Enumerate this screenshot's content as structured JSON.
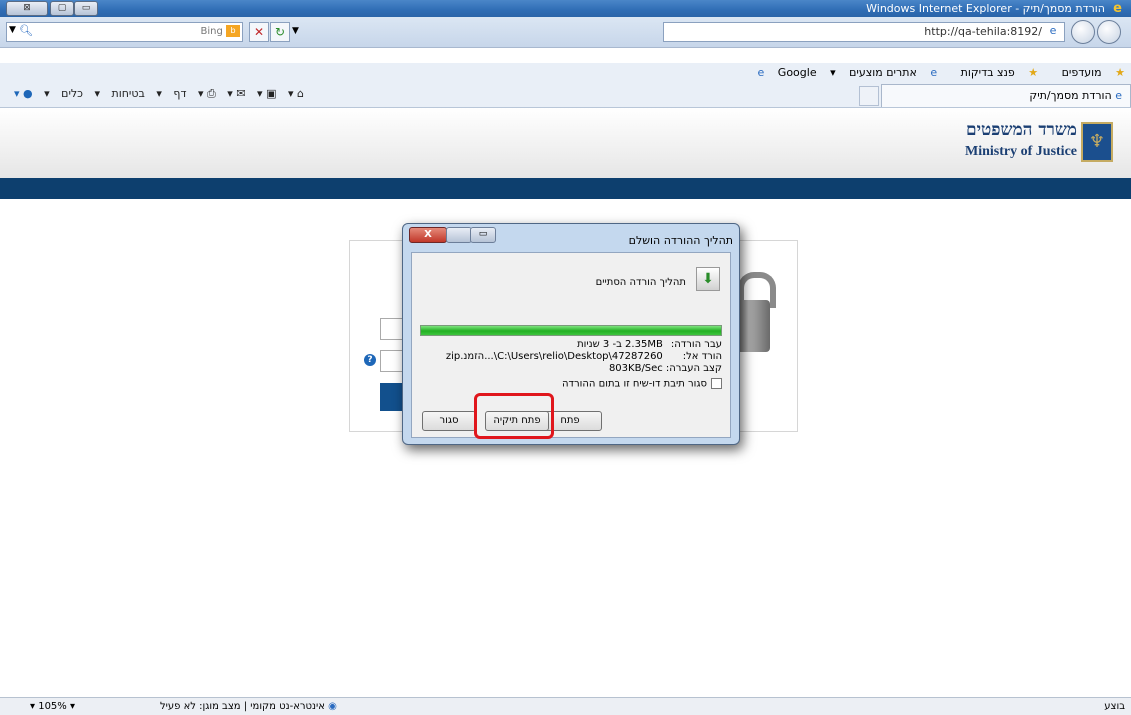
{
  "browser": {
    "title": "הורדת מסמך/תיק - Windows Internet Explorer",
    "url": "http://qa-tehila:8192/",
    "search": {
      "engine": "Bing"
    },
    "favorites": [
      "מועדפים",
      "פנצ בדיקות",
      "אתרים מוצעים",
      "Google"
    ],
    "tab_title": "הורדת מסמך/תיק",
    "commands": [
      "דף",
      "בטיחות",
      "כלים"
    ]
  },
  "page": {
    "header_he": "משרד המשפטים",
    "header_en": "Ministry of Justice"
  },
  "dialog": {
    "title": "תהליך ההורדה הושלם",
    "message": "תהליך הורדה הסתיים",
    "progress": 1.0,
    "rows": [
      {
        "key": "עבר הורדה:",
        "value": "2.35MB ב- 3 שניות"
      },
      {
        "key": "הורד אל:",
        "value": "C:\\Users\\relio\\Desktop\\47287260\\...הזמנ.zip"
      },
      {
        "key": "קצב העברה:",
        "value": "803KB/Sec"
      }
    ],
    "checkbox_label": "סגור תיבת דו-שיח זו בתום ההורדה",
    "buttons": {
      "open": "פתח",
      "open_folder": "פתח תיקיה",
      "close": "סגור"
    }
  },
  "status": {
    "left": "בוצע",
    "zone": "אינטרא-נט מקומי | מצב מוגן: לא פעיל",
    "zoom": "105%"
  },
  "colors": {
    "header_bar": "#0d3f6e",
    "highlight": "#e0161c"
  }
}
